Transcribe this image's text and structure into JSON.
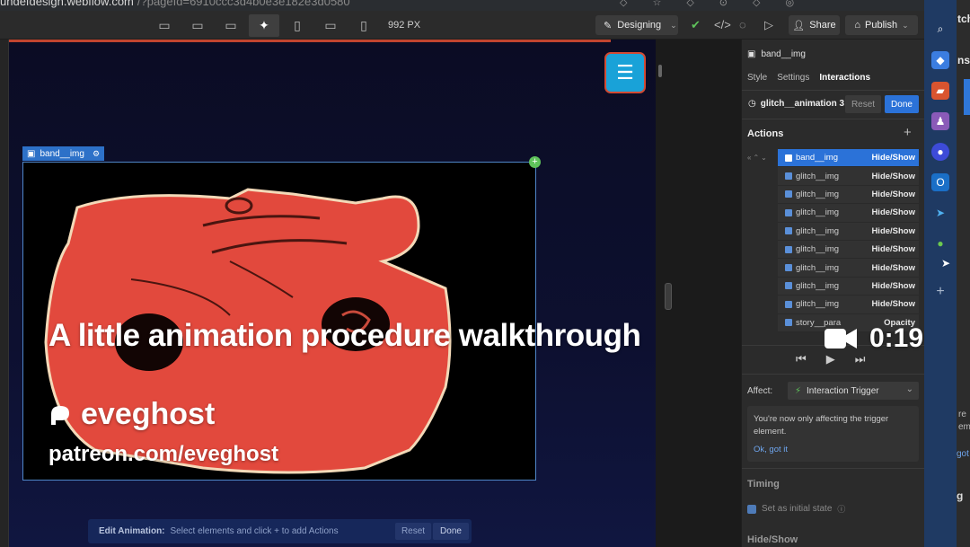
{
  "browser": {
    "url": "undefdesign.webflow.com",
    "url_path": "/?pageId=6910ccc3d4b0e3e182e3d0580"
  },
  "toolbar": {
    "width_readout": "992 PX",
    "mode_label": "Designing",
    "share_label": "Share",
    "publish_label": "Publish"
  },
  "canvas": {
    "selected_element_label": "band__img",
    "edit_animation": {
      "title": "Edit Animation:",
      "hint": "Select elements and click + to add Actions",
      "reset_label": "Reset",
      "done_label": "Done"
    }
  },
  "panel": {
    "element_name": "band__img",
    "tabs": [
      "Style",
      "Settings",
      "Interactions"
    ],
    "active_tab": "Interactions",
    "animation_name": "glitch__animation 3",
    "reset_label": "Reset",
    "done_label": "Done",
    "actions_heading": "Actions",
    "actions": [
      {
        "target": "band__img",
        "type": "Hide/Show",
        "selected": true
      },
      {
        "target": "glitch__img",
        "type": "Hide/Show"
      },
      {
        "target": "glitch__img",
        "type": "Hide/Show"
      },
      {
        "target": "glitch__img",
        "type": "Hide/Show"
      },
      {
        "target": "glitch__img",
        "type": "Hide/Show"
      },
      {
        "target": "glitch__img",
        "type": "Hide/Show"
      },
      {
        "target": "glitch__img",
        "type": "Hide/Show"
      },
      {
        "target": "glitch__img",
        "type": "Hide/Show"
      },
      {
        "target": "glitch__img",
        "type": "Hide/Show"
      },
      {
        "target": "story__para",
        "type": "Opacity"
      }
    ],
    "affect_label": "Affect:",
    "affect_value": "Interaction Trigger",
    "note_text": "You're now only affecting the trigger element.",
    "note_link": "Ok, got it",
    "timing_heading": "Timing",
    "initial_state_label": "Set as initial state",
    "hideshow_heading": "Hide/Show"
  },
  "os_edge": {
    "t1": "tch",
    "t2": "ns",
    "t3": "re\nem",
    "t4": "got",
    "t5": "g"
  },
  "overlay": {
    "title": "A little animation procedure walkthrough",
    "brand": "eveghost",
    "url": "patreon.com/eveghost",
    "timestamp": "0:19"
  },
  "colors": {
    "accent_blue": "#2b72d8",
    "hamburger_bg": "#19a2d8",
    "canvas_bg": "#0b0c24",
    "image_subject_red": "#e2493d"
  }
}
